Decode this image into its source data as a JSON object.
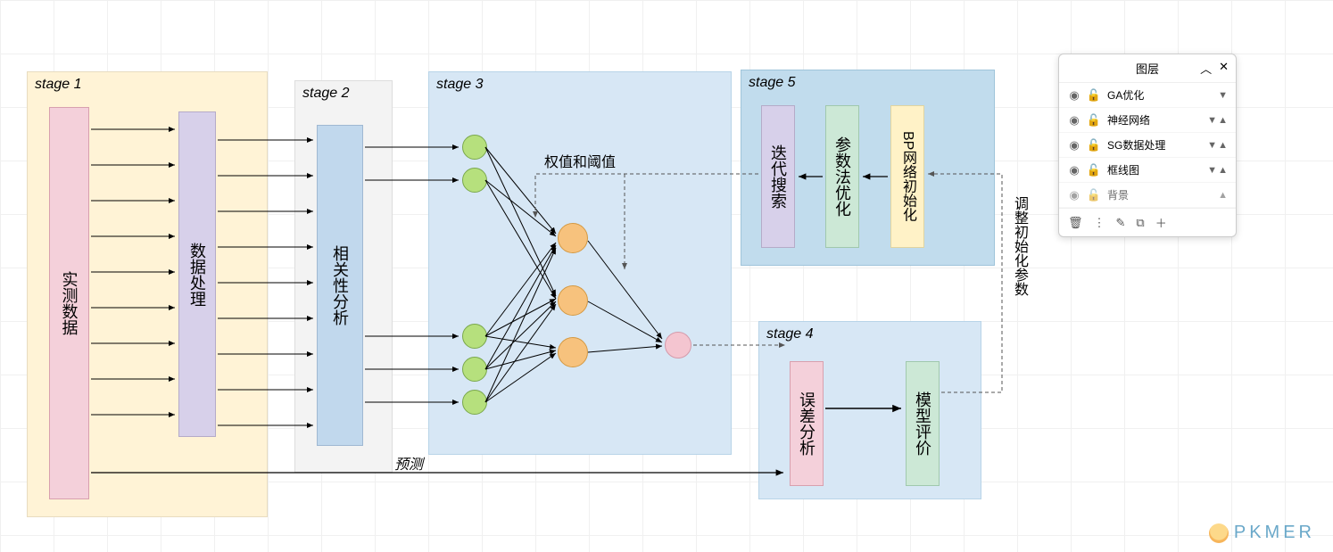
{
  "stages": {
    "s1": "stage 1",
    "s2": "stage 2",
    "s3": "stage 3",
    "s4": "stage 4",
    "s5": "stage 5"
  },
  "blocks": {
    "raw_data": "实测数据",
    "data_proc": "数据处理",
    "corr_analysis": "相关性分析",
    "iter_search": "迭代搜索",
    "param_opt": "参数法优化",
    "bp_init": "BP网络初始化",
    "error_analysis": "误差分析",
    "model_eval": "模型评价"
  },
  "labels": {
    "weights_thresholds": "权值和阈值",
    "adjust_init_params": "调整初始化参数",
    "predict": "预测"
  },
  "layers_panel": {
    "title": "图层",
    "layers": [
      {
        "name": "GA优化",
        "tri": "▼"
      },
      {
        "name": "神经网络",
        "tri": "▼ ▲"
      },
      {
        "name": "SG数据处理",
        "tri": "▼ ▲"
      },
      {
        "name": "框线图",
        "tri": "▼ ▲"
      },
      {
        "name": "背景",
        "tri": "▲"
      }
    ]
  },
  "watermark": "PKMER"
}
